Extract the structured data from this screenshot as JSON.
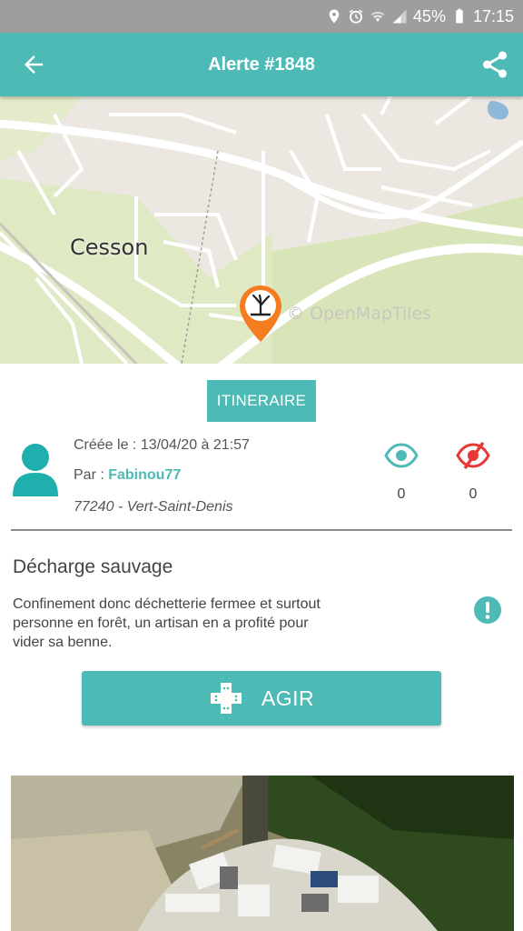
{
  "status_bar": {
    "battery": "45%",
    "time": "17:15",
    "icons": [
      "location-icon",
      "alarm-icon",
      "wifi-icon",
      "signal-icon",
      "battery-icon"
    ]
  },
  "header": {
    "title": "Alerte #1848",
    "back_icon": "arrow-left-icon",
    "share_icon": "share-icon"
  },
  "map": {
    "place_label": "Cesson",
    "attribution": "© OpenMapTiles",
    "marker_icon": "dead-tree-marker-icon"
  },
  "actions": {
    "itinerary_label": "ITINERAIRE",
    "act_label": "AGIR"
  },
  "alert": {
    "created": "Créée le : 13/04/20 à 21:57",
    "by_prefix": "Par : ",
    "author": "Fabinou77",
    "location": "77240 - Vert-Saint-Denis",
    "seen_count": "0",
    "unseen_count": "0",
    "type": "Décharge sauvage",
    "description": "Confinement donc déchetterie fermee et surtout personne en forêt, un artisan en a profité pour vider  sa benne."
  },
  "colors": {
    "primary": "#4dbab5",
    "alert_red": "#e53935",
    "marker_orange": "#f57c1f",
    "status_bar": "#9e9e9e"
  }
}
